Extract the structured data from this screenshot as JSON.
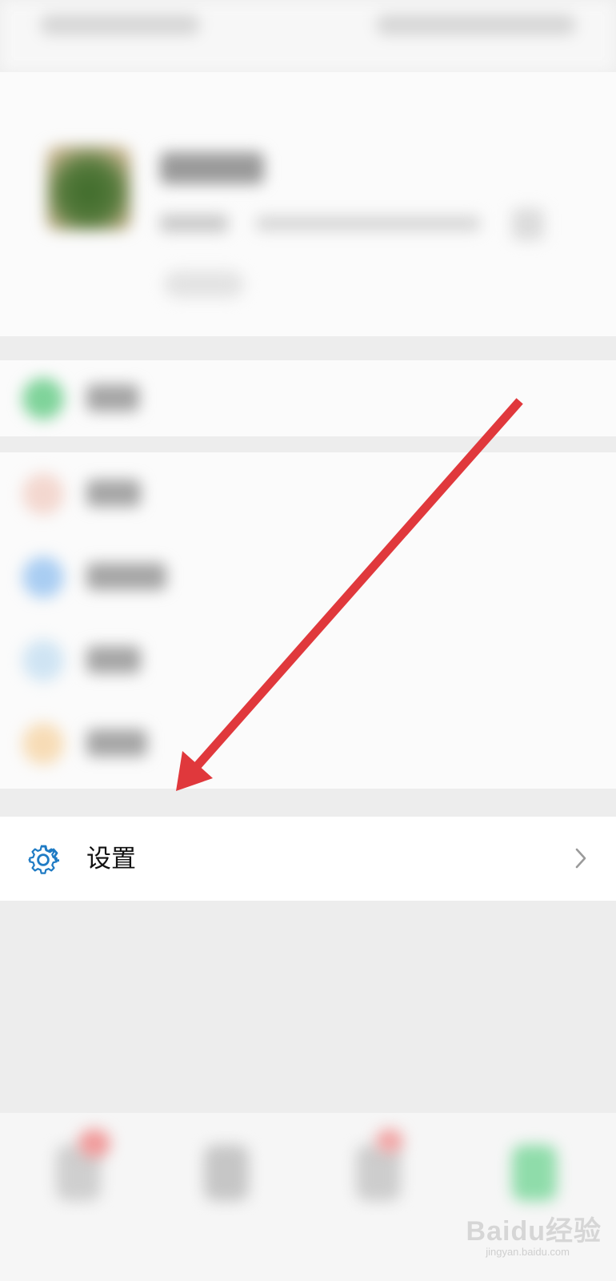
{
  "settings": {
    "label": "设置",
    "icon": "gear-icon",
    "chevron_icon": "chevron-right-icon",
    "accent": "#1f7bc4"
  },
  "annotation": {
    "arrow_color": "#e0383c"
  },
  "watermark": {
    "main": "Baidu经验",
    "sub": "jingyan.baidu.com"
  }
}
